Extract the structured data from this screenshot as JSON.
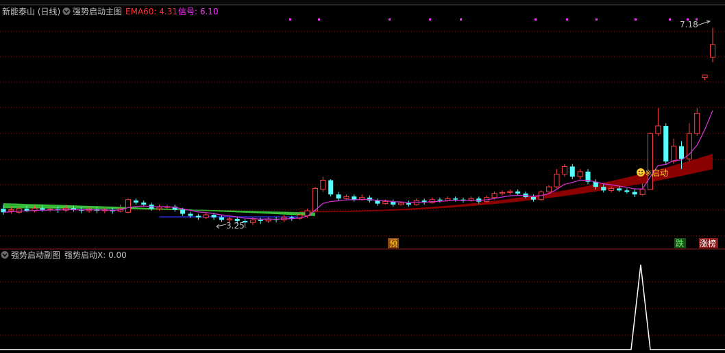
{
  "main_panel": {
    "stock_name": "新能泰山 (日线)",
    "indicator_name": "强势启动主图",
    "ema60_label": "EMA60: 4.31",
    "signal_label": "信号: 6.10",
    "price_high_label": "7.18",
    "price_low_label": "3.25",
    "start_signal_label": "※启动",
    "badge_left": "预",
    "badge_fall": "跌",
    "badge_limit": "涨榜"
  },
  "sub_panel": {
    "indicator_name": "强势启动副图",
    "value_label": "强势启动X: 0.00"
  },
  "colors": {
    "up": "#ff4040",
    "down": "#54ffff",
    "ema": "#cc33cc",
    "ribbon": "#8b0000",
    "bundle": "#33cc33",
    "grid": "#7a1a1a",
    "label_red": "#ff3333",
    "label_magenta": "#ff33ff",
    "label_white": "#c0c0c0",
    "signal_dot": "#ff33ff",
    "badge_bg": "#8b4513"
  },
  "chart_data": {
    "type": "candlestick",
    "series": [
      {
        "name": "EMA60",
        "value": 4.31
      },
      {
        "name": "信号",
        "value": 6.1
      }
    ],
    "annotations": {
      "high": 7.18,
      "low": 3.25
    },
    "candles": [
      [
        3.62,
        3.55,
        3.7,
        3.5
      ],
      [
        3.58,
        3.6,
        3.65,
        3.52
      ],
      [
        3.55,
        3.62,
        3.66,
        3.52
      ],
      [
        3.62,
        3.58,
        3.68,
        3.55
      ],
      [
        3.58,
        3.63,
        3.68,
        3.55
      ],
      [
        3.63,
        3.6,
        3.68,
        3.56
      ],
      [
        3.6,
        3.61,
        3.66,
        3.56
      ],
      [
        3.61,
        3.59,
        3.66,
        3.54
      ],
      [
        3.59,
        3.63,
        3.7,
        3.55
      ],
      [
        3.63,
        3.6,
        3.68,
        3.56
      ],
      [
        3.6,
        3.58,
        3.65,
        3.53
      ],
      [
        3.58,
        3.61,
        3.66,
        3.54
      ],
      [
        3.61,
        3.58,
        3.66,
        3.53
      ],
      [
        3.58,
        3.6,
        3.64,
        3.53
      ],
      [
        3.6,
        3.57,
        3.64,
        3.52
      ],
      [
        3.57,
        3.62,
        3.7,
        3.55
      ],
      [
        3.55,
        3.8,
        3.82,
        3.53
      ],
      [
        3.78,
        3.74,
        3.82,
        3.7
      ],
      [
        3.74,
        3.7,
        3.78,
        3.66
      ],
      [
        3.7,
        3.62,
        3.74,
        3.58
      ],
      [
        3.62,
        3.65,
        3.7,
        3.58
      ],
      [
        3.65,
        3.66,
        3.7,
        3.62
      ],
      [
        3.66,
        3.6,
        3.7,
        3.56
      ],
      [
        3.6,
        3.52,
        3.64,
        3.48
      ],
      [
        3.52,
        3.48,
        3.56,
        3.44
      ],
      [
        3.48,
        3.45,
        3.52,
        3.4
      ],
      [
        3.45,
        3.5,
        3.54,
        3.42
      ],
      [
        3.5,
        3.45,
        3.54,
        3.4
      ],
      [
        3.45,
        3.4,
        3.5,
        3.36
      ],
      [
        3.4,
        3.42,
        3.46,
        3.35
      ],
      [
        3.42,
        3.38,
        3.46,
        3.32
      ],
      [
        3.38,
        3.35,
        3.42,
        3.25
      ],
      [
        3.35,
        3.4,
        3.45,
        3.3
      ],
      [
        3.4,
        3.38,
        3.44,
        3.32
      ],
      [
        3.38,
        3.42,
        3.46,
        3.34
      ],
      [
        3.42,
        3.4,
        3.46,
        3.35
      ],
      [
        3.4,
        3.45,
        3.5,
        3.36
      ],
      [
        3.45,
        3.43,
        3.48,
        3.38
      ],
      [
        3.43,
        3.5,
        3.55,
        3.4
      ],
      [
        3.48,
        3.58,
        3.62,
        3.44
      ],
      [
        3.58,
        4.02,
        4.05,
        3.56
      ],
      [
        4.0,
        4.18,
        4.25,
        3.95
      ],
      [
        4.18,
        3.9,
        4.2,
        3.86
      ],
      [
        3.9,
        3.82,
        3.95,
        3.78
      ],
      [
        3.82,
        3.86,
        3.9,
        3.78
      ],
      [
        3.86,
        3.8,
        3.9,
        3.76
      ],
      [
        3.8,
        3.84,
        3.9,
        3.78
      ],
      [
        3.84,
        3.78,
        3.88,
        3.74
      ],
      [
        3.78,
        3.72,
        3.82,
        3.68
      ],
      [
        3.72,
        3.76,
        3.8,
        3.7
      ],
      [
        3.76,
        3.7,
        3.8,
        3.66
      ],
      [
        3.7,
        3.73,
        3.76,
        3.68
      ],
      [
        3.73,
        3.7,
        3.78,
        3.66
      ],
      [
        3.7,
        3.78,
        3.82,
        3.68
      ],
      [
        3.78,
        3.74,
        3.82,
        3.7
      ],
      [
        3.74,
        3.8,
        3.84,
        3.72
      ],
      [
        3.8,
        3.78,
        3.84,
        3.74
      ],
      [
        3.78,
        3.82,
        3.86,
        3.76
      ],
      [
        3.82,
        3.8,
        3.86,
        3.76
      ],
      [
        3.8,
        3.78,
        3.84,
        3.74
      ],
      [
        3.78,
        3.82,
        3.86,
        3.76
      ],
      [
        3.82,
        3.76,
        3.86,
        3.72
      ],
      [
        3.76,
        3.84,
        3.88,
        3.74
      ],
      [
        3.84,
        3.92,
        3.96,
        3.8
      ],
      [
        3.92,
        3.94,
        3.98,
        3.88
      ],
      [
        3.94,
        3.96,
        4.0,
        3.9
      ],
      [
        3.96,
        3.92,
        4.0,
        3.88
      ],
      [
        3.92,
        3.85,
        3.96,
        3.82
      ],
      [
        3.85,
        3.8,
        3.9,
        3.76
      ],
      [
        3.8,
        3.95,
        3.98,
        3.78
      ],
      [
        3.95,
        4.05,
        4.08,
        3.92
      ],
      [
        4.05,
        4.3,
        4.4,
        4.02
      ],
      [
        4.3,
        4.45,
        4.5,
        4.25
      ],
      [
        4.45,
        4.25,
        4.5,
        4.2
      ],
      [
        4.25,
        4.35,
        4.4,
        4.2
      ],
      [
        4.35,
        4.15,
        4.4,
        4.1
      ],
      [
        4.15,
        4.05,
        4.2,
        4.0
      ],
      [
        4.05,
        3.98,
        4.1,
        3.94
      ],
      [
        3.98,
        4.02,
        4.06,
        3.94
      ],
      [
        4.02,
        3.98,
        4.06,
        3.95
      ],
      [
        3.98,
        3.95,
        4.02,
        3.92
      ],
      [
        3.95,
        3.9,
        4.0,
        3.85
      ],
      [
        3.9,
        4.0,
        4.12,
        3.88
      ],
      [
        4.0,
        5.1,
        5.12,
        4.0
      ],
      [
        5.1,
        5.25,
        5.6,
        5.05
      ],
      [
        5.25,
        4.55,
        5.3,
        4.5
      ],
      [
        4.55,
        4.85,
        5.0,
        4.5
      ],
      [
        4.85,
        4.6,
        4.95,
        4.4
      ],
      [
        4.6,
        5.1,
        5.3,
        4.55
      ],
      [
        5.1,
        5.5,
        5.6,
        5.05
      ],
      [
        6.2,
        6.25,
        6.25,
        6.15
      ],
      [
        6.6,
        6.85,
        7.18,
        6.5
      ]
    ]
  }
}
